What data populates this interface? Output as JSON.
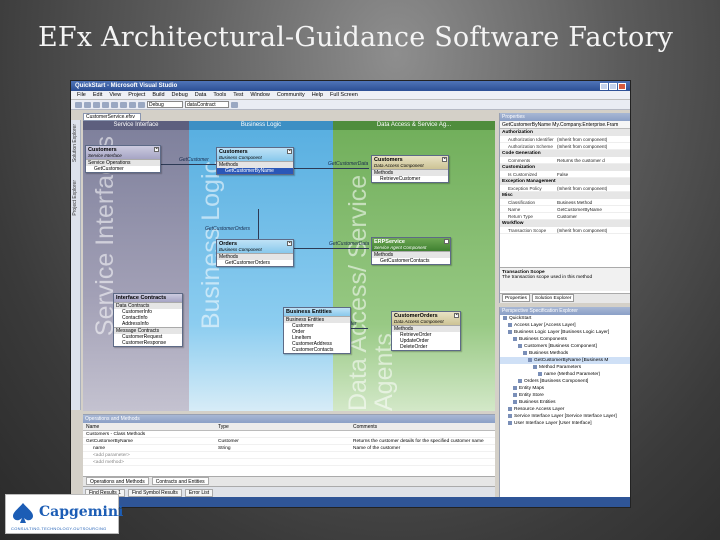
{
  "slide": {
    "title": "EFx Architectural-Guidance Software Factory"
  },
  "vs": {
    "window_title": "QuickStart - Microsoft Visual Studio",
    "menu": [
      "File",
      "Edit",
      "View",
      "Project",
      "Build",
      "Debug",
      "Data",
      "Tools",
      "Test",
      "Window",
      "Community",
      "Help"
    ],
    "fullscreen_label": "Full Screen",
    "toolbar_combo1": "Debug",
    "toolbar_combo2": "dataContract",
    "left_tab1": "Solution Explorer",
    "left_tab2": "Project Explorer",
    "doc_tab": "CustomerService.efxv"
  },
  "lanes": {
    "l1_head": "Service Interface",
    "l1_big": "Service Interfaces",
    "l2_head": "Business Logic",
    "l2_big": "Business Logic",
    "l3_head": "Data Access & Service Ag...",
    "l3_big": "Data Access/ Service Agents"
  },
  "shapes": {
    "customers_svc": {
      "name": "Customers",
      "type": "Service Interface",
      "sec": "Service Operations",
      "item": "GetCustomer"
    },
    "customers_bl": {
      "name": "Customers",
      "type": "Business Component",
      "sec": "Methods",
      "item": "GetCustomerByName"
    },
    "customers_da": {
      "name": "Customers",
      "type": "Data Access Component",
      "sec": "Methods",
      "item": "RetrieveCustomer"
    },
    "orders_bl": {
      "name": "Orders",
      "type": "Business Component",
      "sec": "Methods",
      "item": "GetCustomerOrders"
    },
    "erp_svc": {
      "name": "ERPService",
      "type": "Service Agent Component",
      "sec": "Methods",
      "item": "GetCustomerContacts"
    },
    "iface": {
      "name": "Interface Contracts",
      "sec1": "Data Contracts",
      "items1": [
        "CustomerInfo",
        "ContactInfo",
        "AddressInfo"
      ],
      "sec2": "Message Contracts",
      "items2": [
        "CustomerRequest",
        "CustomerResponse"
      ]
    },
    "biz": {
      "name": "Business Entities",
      "sec": "Business Entities",
      "items": [
        "Customer",
        "Order",
        "LineItem",
        "CustomerAddress",
        "CustomerContacts"
      ]
    },
    "custorders": {
      "name": "CustomerOrders",
      "type": "Data Access Component",
      "sec": "Methods",
      "items": [
        "RetrieveOrder",
        "UpdateOrder",
        "DeleteOrder"
      ]
    }
  },
  "connectors": {
    "c1": "GetCustomer",
    "c2": "GetCustomerData",
    "c3": "GetCustomerOrders",
    "c4": "GetCustomerData",
    "c5": "RetrieveOrder"
  },
  "properties": {
    "title": "Properties",
    "selected": "GetCustomerByName My.Company.Enterprise.Fram",
    "cats": [
      {
        "name": "Authorization",
        "rows": [
          [
            "Authorization Identifier",
            "(Inherit from component)"
          ],
          [
            "Authorization Scheme",
            "(Inherit from component)"
          ]
        ]
      },
      {
        "name": "Code Generation",
        "rows": [
          [
            "Comments",
            "Returns the customer d"
          ]
        ]
      },
      {
        "name": "Customization",
        "rows": [
          [
            "Is Customized",
            "False"
          ]
        ]
      },
      {
        "name": "Exception Management",
        "rows": [
          [
            "Exception Policy",
            "(Inherit from component)"
          ]
        ]
      },
      {
        "name": "Misc",
        "rows": [
          [
            "Classification",
            "Business Method"
          ],
          [
            "Name",
            "GetCustomerByName"
          ],
          [
            "Return Type",
            "Customer"
          ]
        ]
      },
      {
        "name": "Workflow",
        "rows": [
          [
            "Transaction Scope",
            "(Inherit from component)"
          ]
        ]
      }
    ],
    "desc_title": "Transaction Scope",
    "desc_text": "The transaction scope used in this method",
    "tabs": [
      "Properties",
      "Solution Explorer"
    ]
  },
  "explorer": {
    "title": "Perspective Specification Explorer",
    "nodes": [
      "QuickStart",
      "Access Layer [Access Layer]",
      "Business Logic Layer [Business Logic Layer]",
      "Business Components",
      "Customers [Business Component]",
      "Business Methods",
      "GetCustomerByName [Business M",
      "Method Parameters",
      "name (Method Parameter)",
      "Orders [Business Component]",
      "Entity Maps",
      "Entity Store",
      "Business Entities",
      "Resource Access Layer",
      "Service Interface Layer [Service Interface Layer]",
      "User Interface Layer [User Interface]"
    ]
  },
  "grid": {
    "title": "Operations and Methods",
    "headers": [
      "Name",
      "Type",
      "Comments"
    ],
    "rows": [
      [
        "Customers - Class Methods",
        "",
        ""
      ],
      [
        "GetCustomerByName",
        "Customer",
        "Returns the customer details for the specified customer name"
      ],
      [
        "name",
        "String",
        "Name of the customer"
      ],
      [
        "<add parameter>",
        "",
        ""
      ],
      [
        "<add method>",
        "",
        ""
      ]
    ],
    "tabs": [
      "Operations and Methods",
      "Contracts and Entities"
    ]
  },
  "output_tabs": [
    "Find Results 1",
    "Find Symbol Results",
    "Error List"
  ],
  "status": "Item(s) Saved",
  "logo": {
    "name": "Capgemini",
    "sub": "CONSULTING.TECHNOLOGY.OUTSOURCING"
  },
  "colors": {
    "service_lane": "#7d7f9b",
    "logic_lane": "#57aee0",
    "data_lane": "#70ae5a",
    "selection": "#2a57b8"
  }
}
